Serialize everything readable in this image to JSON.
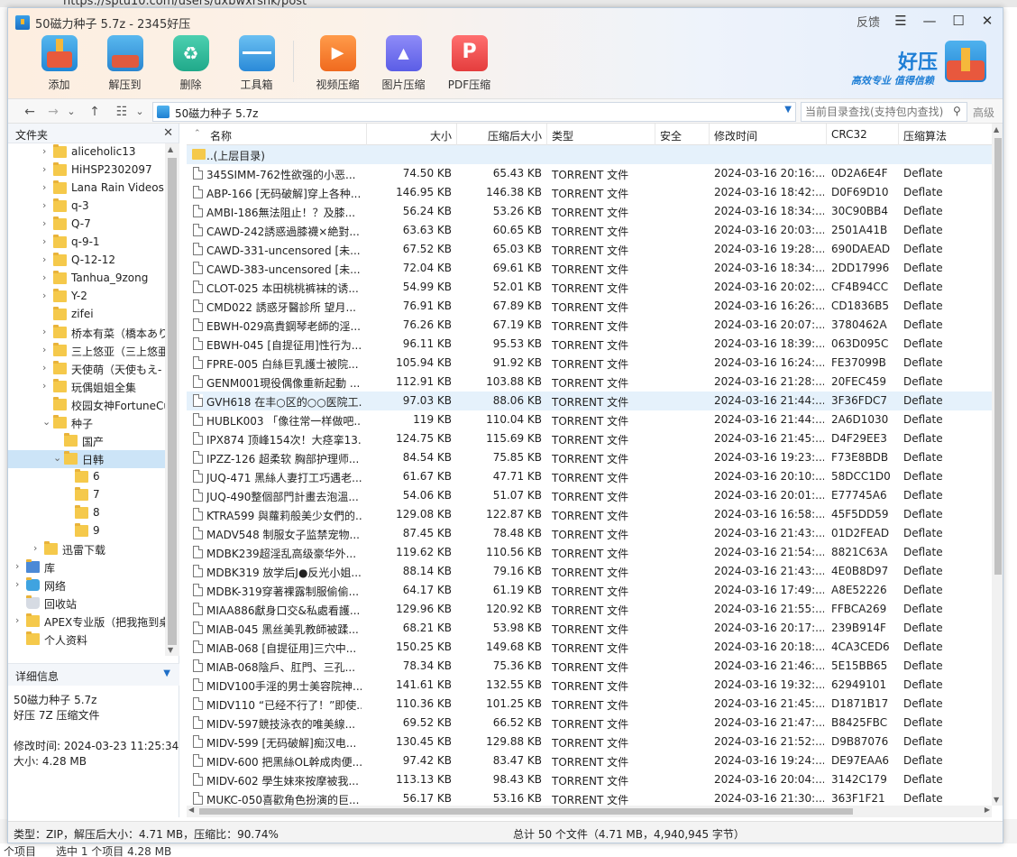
{
  "background": {
    "url": "https://sptu10.com/users/uxbwxrshk/post",
    "bottom_left": "个项目",
    "bottom_selected": "选中 1 个项目  4.28 MB"
  },
  "window": {
    "title": "50磁力种子 5.7z - 2345好压",
    "feedback": "反馈",
    "menu_glyph": "☰",
    "min_glyph": "—",
    "max_glyph": "☐",
    "close_glyph": "✕"
  },
  "toolbar": {
    "add": "添加",
    "extract": "解压到",
    "delete": "删除",
    "tools": "工具箱",
    "video": "视频压缩",
    "image": "图片压缩",
    "pdf": "PDF压缩"
  },
  "brand": {
    "name": "好压",
    "slogan": "高效专业  值得信赖"
  },
  "addressbar": {
    "back": "←",
    "forward": "→",
    "dropdown": "⌄",
    "up": "↑",
    "view": "☷",
    "view_dd": "⌄",
    "path": "50磁力种子 5.7z",
    "path_dd": "▼",
    "search_placeholder": "当前目录查找(支持包内查找)",
    "search_icon": "⚲",
    "advanced": "高级"
  },
  "left_pane": {
    "folders_title": "文件夹",
    "close": "✕",
    "tree": [
      {
        "label": "aliceholic13",
        "level": 2,
        "arrow": "›"
      },
      {
        "label": "HiHSP2302097",
        "level": 2,
        "arrow": "›"
      },
      {
        "label": "Lana Rain Videos",
        "level": 2,
        "arrow": "›"
      },
      {
        "label": "q-3",
        "level": 2,
        "arrow": "›"
      },
      {
        "label": "Q-7",
        "level": 2,
        "arrow": "›"
      },
      {
        "label": "q-9-1",
        "level": 2,
        "arrow": "›"
      },
      {
        "label": "Q-12-12",
        "level": 2,
        "arrow": "›"
      },
      {
        "label": "Tanhua_9zong",
        "level": 2,
        "arrow": "›"
      },
      {
        "label": "Y-2",
        "level": 2,
        "arrow": "›"
      },
      {
        "label": "zifei",
        "level": 2,
        "arrow": ""
      },
      {
        "label": "桥本有菜（橋本あり",
        "level": 2,
        "arrow": "›"
      },
      {
        "label": "三上悠亚（三上悠亜",
        "level": 2,
        "arrow": "›"
      },
      {
        "label": "天使萌（天使もえ-",
        "level": 2,
        "arrow": "›"
      },
      {
        "label": "玩偶姐姐全集",
        "level": 2,
        "arrow": "›"
      },
      {
        "label": "校园女神FortuneCu",
        "level": 2,
        "arrow": ""
      },
      {
        "label": "种子",
        "level": 2,
        "arrow": "⌄"
      },
      {
        "label": "国产",
        "level": 3,
        "arrow": ""
      },
      {
        "label": "日韩",
        "level": 3,
        "arrow": "⌄",
        "selected": true
      },
      {
        "label": "6",
        "level": 4,
        "arrow": ""
      },
      {
        "label": "7",
        "level": 4,
        "arrow": ""
      },
      {
        "label": "8",
        "level": 4,
        "arrow": ""
      },
      {
        "label": "9",
        "level": 4,
        "arrow": ""
      },
      {
        "label": "迅雷下载",
        "level": 1.5,
        "arrow": "›"
      },
      {
        "label": "库",
        "level": 0,
        "arrow": "›",
        "icon": "lib"
      },
      {
        "label": "网络",
        "level": 0,
        "arrow": "›",
        "icon": "net"
      },
      {
        "label": "回收站",
        "level": 0,
        "arrow": "",
        "icon": "bin"
      },
      {
        "label": "APEX专业版（把我拖到桌",
        "level": 0,
        "arrow": "›",
        "icon": "folder"
      },
      {
        "label": "个人资料",
        "level": 0,
        "arrow": "",
        "icon": "user"
      }
    ],
    "detail_title": "详细信息",
    "detail_dd": "▼",
    "detail": {
      "name": "50磁力种子 5.7z",
      "type": "好压 7Z 压缩文件",
      "modified": "修改时间:  2024-03-23 11:25:34",
      "size": "大小:  4.28 MB"
    }
  },
  "list": {
    "sort_arrow": "⌃",
    "columns": {
      "name": "名称",
      "size": "大小",
      "packed": "压缩后大小",
      "type": "类型",
      "security": "安全",
      "modified": "修改时间",
      "crc": "CRC32",
      "method": "压缩算法"
    },
    "parent": "..(上层目录)",
    "rows": [
      {
        "name": "345SIMM-762性欲强的小恶...",
        "size": "74.50 KB",
        "packed": "65.43 KB",
        "type": "TORRENT 文件",
        "modified": "2024-03-16 20:16:...",
        "crc": "0D2A6E4F",
        "method": "Deflate"
      },
      {
        "name": "ABP-166 [无码破解]穿上各种...",
        "size": "146.95 KB",
        "packed": "146.38 KB",
        "type": "TORRENT 文件",
        "modified": "2024-03-16 18:42:...",
        "crc": "D0F69D10",
        "method": "Deflate"
      },
      {
        "name": "AMBI-186無法阻止！？及膝...",
        "size": "56.24 KB",
        "packed": "53.26 KB",
        "type": "TORRENT 文件",
        "modified": "2024-03-16 18:34:...",
        "crc": "30C90BB4",
        "method": "Deflate"
      },
      {
        "name": "CAWD-242誘惑過膝襪×絶對...",
        "size": "63.63 KB",
        "packed": "60.65 KB",
        "type": "TORRENT 文件",
        "modified": "2024-03-16 20:03:...",
        "crc": "2501A41B",
        "method": "Deflate"
      },
      {
        "name": "CAWD-331-uncensored [未...",
        "size": "67.52 KB",
        "packed": "65.03 KB",
        "type": "TORRENT 文件",
        "modified": "2024-03-16 19:28:...",
        "crc": "690DAEAD",
        "method": "Deflate"
      },
      {
        "name": "CAWD-383-uncensored [未...",
        "size": "72.04 KB",
        "packed": "69.61 KB",
        "type": "TORRENT 文件",
        "modified": "2024-03-16 18:34:...",
        "crc": "2DD17996",
        "method": "Deflate"
      },
      {
        "name": "CLOT-025 本田桃桃裤袜的诱...",
        "size": "54.99 KB",
        "packed": "52.01 KB",
        "type": "TORRENT 文件",
        "modified": "2024-03-16 20:02:...",
        "crc": "CF4B94CC",
        "method": "Deflate"
      },
      {
        "name": "CMD022 誘惑牙醫診所 望月...",
        "size": "76.91 KB",
        "packed": "67.89 KB",
        "type": "TORRENT 文件",
        "modified": "2024-03-16 16:26:...",
        "crc": "CD1836B5",
        "method": "Deflate"
      },
      {
        "name": "EBWH-029高貴鋼琴老師的淫...",
        "size": "76.26 KB",
        "packed": "67.19 KB",
        "type": "TORRENT 文件",
        "modified": "2024-03-16 20:07:...",
        "crc": "3780462A",
        "method": "Deflate"
      },
      {
        "name": "EBWH-045 [自提征用]性行为...",
        "size": "96.11 KB",
        "packed": "95.53 KB",
        "type": "TORRENT 文件",
        "modified": "2024-03-16 18:39:...",
        "crc": "063D095C",
        "method": "Deflate"
      },
      {
        "name": "FPRE-005 白絲巨乳護士被院...",
        "size": "105.94 KB",
        "packed": "91.92 KB",
        "type": "TORRENT 文件",
        "modified": "2024-03-16 16:24:...",
        "crc": "FE37099B",
        "method": "Deflate"
      },
      {
        "name": "GENM001現役偶像重新起動 ...",
        "size": "112.91 KB",
        "packed": "103.88 KB",
        "type": "TORRENT 文件",
        "modified": "2024-03-16 21:28:...",
        "crc": "20FEC459",
        "method": "Deflate"
      },
      {
        "name": "GVH618 在丰○区的○○医院工...",
        "size": "97.03 KB",
        "packed": "88.06 KB",
        "type": "TORRENT 文件",
        "modified": "2024-03-16 21:44:...",
        "crc": "3F36FDC7",
        "method": "Deflate",
        "hl": true
      },
      {
        "name": "HUBLK003 「像往常一样做吧...",
        "size": "119 KB",
        "packed": "110.04 KB",
        "type": "TORRENT 文件",
        "modified": "2024-03-16 21:44:...",
        "crc": "2A6D1030",
        "method": "Deflate"
      },
      {
        "name": "IPX874 顶峰154次！大痉挛13...",
        "size": "124.75 KB",
        "packed": "115.69 KB",
        "type": "TORRENT 文件",
        "modified": "2024-03-16 21:45:...",
        "crc": "D4F29EE3",
        "method": "Deflate"
      },
      {
        "name": "IPZZ-126 超柔软 胸部护理师...",
        "size": "84.54 KB",
        "packed": "75.85 KB",
        "type": "TORRENT 文件",
        "modified": "2024-03-16 19:23:...",
        "crc": "F73E8BDB",
        "method": "Deflate"
      },
      {
        "name": "JUQ-471 黑絲人妻打工巧遇老...",
        "size": "61.67 KB",
        "packed": "47.71 KB",
        "type": "TORRENT 文件",
        "modified": "2024-03-16 20:10:...",
        "crc": "58DCC1D0",
        "method": "Deflate"
      },
      {
        "name": "JUQ-490整個部門計畫去泡溫...",
        "size": "54.06 KB",
        "packed": "51.07 KB",
        "type": "TORRENT 文件",
        "modified": "2024-03-16 20:01:...",
        "crc": "E77745A6",
        "method": "Deflate"
      },
      {
        "name": "KTRA599 與蘿莉般美少女們的...",
        "size": "129.08 KB",
        "packed": "122.87 KB",
        "type": "TORRENT 文件",
        "modified": "2024-03-16 16:58:...",
        "crc": "45F5DD59",
        "method": "Deflate"
      },
      {
        "name": "MADV548 制服女子监禁宠物...",
        "size": "87.45 KB",
        "packed": "78.48 KB",
        "type": "TORRENT 文件",
        "modified": "2024-03-16 21:43:...",
        "crc": "01D2FEAD",
        "method": "Deflate"
      },
      {
        "name": "MDBK239超淫乱高级豪华外...",
        "size": "119.62 KB",
        "packed": "110.56 KB",
        "type": "TORRENT 文件",
        "modified": "2024-03-16 21:54:...",
        "crc": "8821C63A",
        "method": "Deflate"
      },
      {
        "name": "MDBK319 放学后J●反光小姐...",
        "size": "88.14 KB",
        "packed": "79.16 KB",
        "type": "TORRENT 文件",
        "modified": "2024-03-16 21:43:...",
        "crc": "4E0B8D97",
        "method": "Deflate"
      },
      {
        "name": "MDBK-319穿著裸露制服偷偷...",
        "size": "64.17 KB",
        "packed": "61.19 KB",
        "type": "TORRENT 文件",
        "modified": "2024-03-16 17:49:...",
        "crc": "A8E52226",
        "method": "Deflate"
      },
      {
        "name": "MIAA886獻身口交&私處看護...",
        "size": "129.96 KB",
        "packed": "120.92 KB",
        "type": "TORRENT 文件",
        "modified": "2024-03-16 21:55:...",
        "crc": "FFBCA269",
        "method": "Deflate"
      },
      {
        "name": "MIAB-045 黑丝美乳教師被蹂...",
        "size": "68.21 KB",
        "packed": "53.98 KB",
        "type": "TORRENT 文件",
        "modified": "2024-03-16 20:17:...",
        "crc": "239B914F",
        "method": "Deflate"
      },
      {
        "name": "MIAB-068 [自提征用]三穴中...",
        "size": "150.25 KB",
        "packed": "149.68 KB",
        "type": "TORRENT 文件",
        "modified": "2024-03-16 20:18:...",
        "crc": "4CA3CED6",
        "method": "Deflate"
      },
      {
        "name": "MIAB-068陰戶、肛門、三孔...",
        "size": "78.34 KB",
        "packed": "75.36 KB",
        "type": "TORRENT 文件",
        "modified": "2024-03-16 21:46:...",
        "crc": "5E15BB65",
        "method": "Deflate"
      },
      {
        "name": "MIDV100手淫的男士美容院神...",
        "size": "141.61 KB",
        "packed": "132.55 KB",
        "type": "TORRENT 文件",
        "modified": "2024-03-16 19:32:...",
        "crc": "62949101",
        "method": "Deflate"
      },
      {
        "name": "MIDV110 “已经不行了！”即使...",
        "size": "110.36 KB",
        "packed": "101.25 KB",
        "type": "TORRENT 文件",
        "modified": "2024-03-16 21:45:...",
        "crc": "D1871B17",
        "method": "Deflate"
      },
      {
        "name": "MIDV-597競技泳衣的唯美線...",
        "size": "69.52 KB",
        "packed": "66.52 KB",
        "type": "TORRENT 文件",
        "modified": "2024-03-16 21:47:...",
        "crc": "B8425FBC",
        "method": "Deflate"
      },
      {
        "name": "MIDV-599 [无码破解]痴汉电...",
        "size": "130.45 KB",
        "packed": "129.88 KB",
        "type": "TORRENT 文件",
        "modified": "2024-03-16 21:52:...",
        "crc": "D9B87076",
        "method": "Deflate"
      },
      {
        "name": "MIDV-600 把黑絲OL幹成肉便...",
        "size": "97.42 KB",
        "packed": "83.47 KB",
        "type": "TORRENT 文件",
        "modified": "2024-03-16 19:24:...",
        "crc": "DE97EAA6",
        "method": "Deflate"
      },
      {
        "name": "MIDV-602 學生妹來按摩被我...",
        "size": "113.13 KB",
        "packed": "98.43 KB",
        "type": "TORRENT 文件",
        "modified": "2024-03-16 20:04:...",
        "crc": "3142C179",
        "method": "Deflate"
      },
      {
        "name": "MUKC-050喜歡角色扮演的巨...",
        "size": "56.17 KB",
        "packed": "53.16 KB",
        "type": "TORRENT 文件",
        "modified": "2024-03-16 21:30:...",
        "crc": "363F1F21",
        "method": "Deflate"
      }
    ]
  },
  "scroll": {
    "up": "▲",
    "down": "▼",
    "left": "◀",
    "right": "▶"
  },
  "statusbar": {
    "left": "类型：ZIP，解压后大小：4.71 MB，压缩比：90.74%",
    "mid": "总计 50 个文件（4.71 MB，4,940,945 字节）"
  },
  "colors": {
    "accent": "#1f7fd6",
    "selection": "#cce4f7",
    "row_highlight": "#e5f1fb"
  }
}
